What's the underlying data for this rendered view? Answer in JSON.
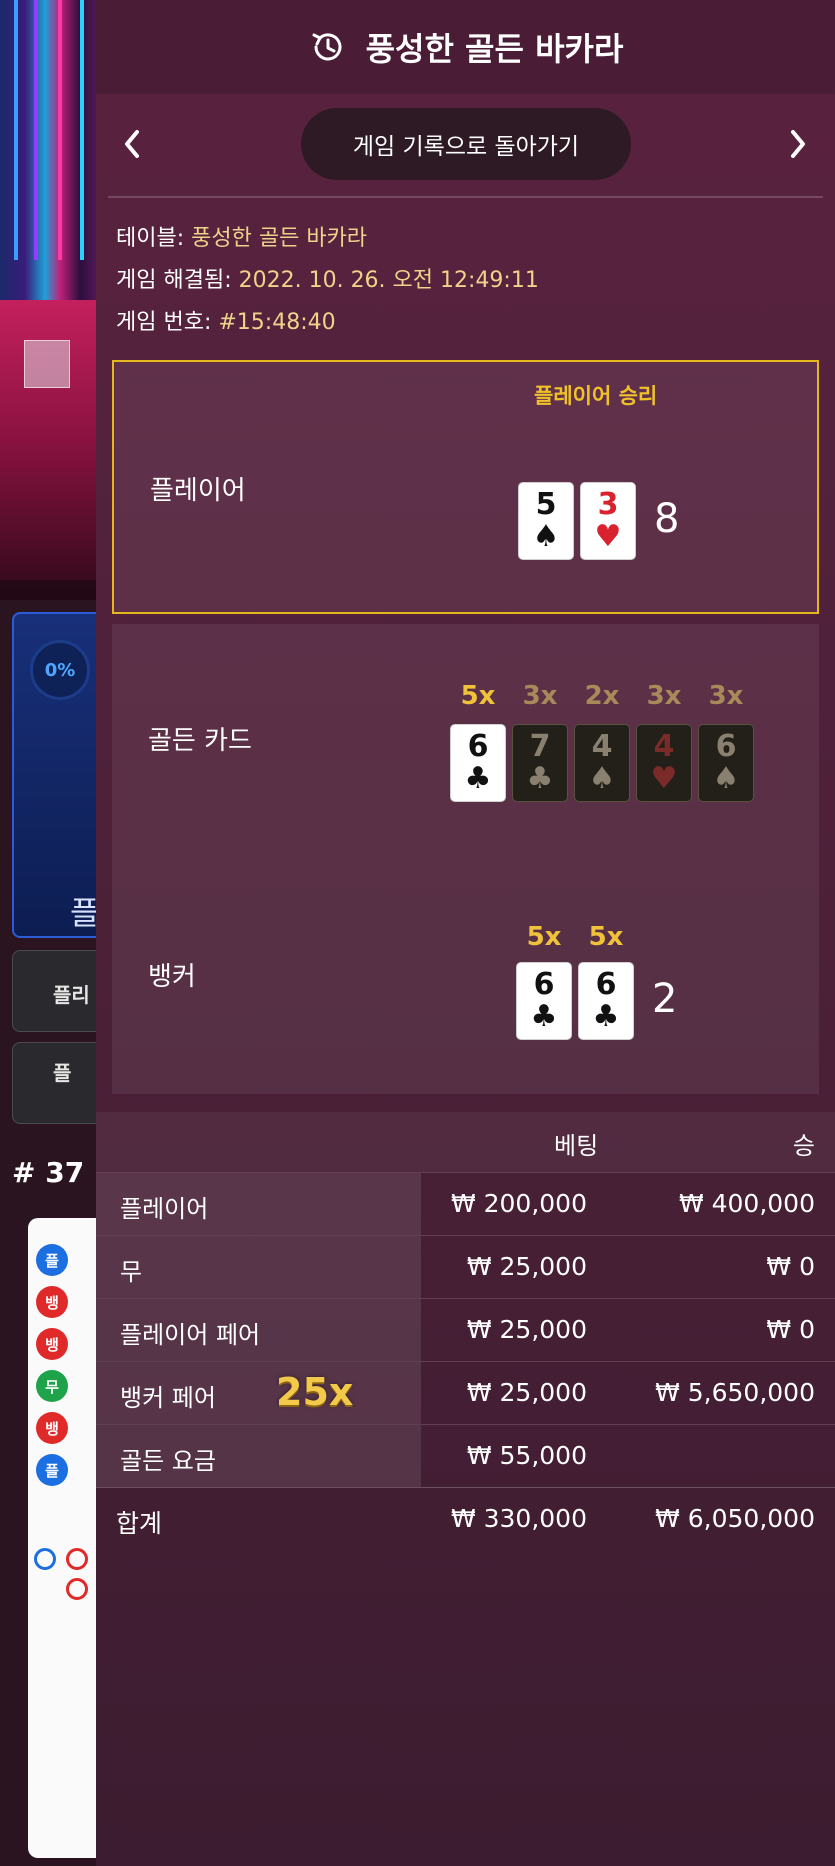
{
  "background": {
    "bet_percent": "0%",
    "bet_area_label": "플",
    "button1_label": "플리",
    "button2_label": "플",
    "round_label": "# 37",
    "bead_road": [
      "플",
      "뱅",
      "뱅",
      "무",
      "뱅",
      "플"
    ]
  },
  "header": {
    "title": "풍성한 골든 바카라",
    "icon": "history-icon"
  },
  "nav": {
    "back_label": "게임 기록으로 돌아가기",
    "prev_icon": "chevron-left-icon",
    "next_icon": "chevron-right-icon"
  },
  "info": {
    "table_label": "테이블: ",
    "table_value": "풍성한 골든 바카라",
    "resolved_label": "게임 해결됨: ",
    "resolved_value": "2022. 10. 26. 오전 12:49:11",
    "number_label": "게임 번호: ",
    "number_value": "#15:48:40"
  },
  "player": {
    "label": "플레이어",
    "result": "플레이어 승리",
    "cards": [
      {
        "rank": "5",
        "suit": "♠",
        "color": "black"
      },
      {
        "rank": "3",
        "suit": "♥",
        "color": "red"
      }
    ],
    "score": "8"
  },
  "golden": {
    "label": "골든 카드",
    "cards": [
      {
        "rank": "6",
        "suit": "♣",
        "color": "black",
        "mult": "5x",
        "active": true
      },
      {
        "rank": "7",
        "suit": "♣",
        "color": "black",
        "mult": "3x",
        "active": false
      },
      {
        "rank": "4",
        "suit": "♠",
        "color": "black",
        "mult": "2x",
        "active": false
      },
      {
        "rank": "4",
        "suit": "♥",
        "color": "red",
        "mult": "3x",
        "active": false
      },
      {
        "rank": "6",
        "suit": "♠",
        "color": "black",
        "mult": "3x",
        "active": false
      }
    ]
  },
  "banker": {
    "label": "뱅커",
    "cards": [
      {
        "rank": "6",
        "suit": "♣",
        "color": "black",
        "mult": "5x"
      },
      {
        "rank": "6",
        "suit": "♣",
        "color": "black",
        "mult": "5x"
      }
    ],
    "score": "2"
  },
  "bets": {
    "col_bet": "베팅",
    "col_win": "승",
    "rows": [
      {
        "name": "플레이어",
        "bet": "₩ 200,000",
        "win": "₩ 400,000"
      },
      {
        "name": "무",
        "bet": "₩ 25,000",
        "win": "₩ 0"
      },
      {
        "name": "플레이어 페어",
        "bet": "₩ 25,000",
        "win": "₩ 0"
      },
      {
        "name": "뱅커 페어",
        "bet": "₩ 25,000",
        "win": "₩ 5,650,000",
        "badge": "25x"
      },
      {
        "name": "골든 요금",
        "bet": "₩ 55,000",
        "win": ""
      }
    ],
    "total": {
      "name": "합계",
      "bet": "₩ 330,000",
      "win": "₩ 6,050,000"
    }
  },
  "colors": {
    "accent_gold": "#f0c22a",
    "panel_bg": "#4c2138",
    "player_win_border": "#e4b81c"
  }
}
